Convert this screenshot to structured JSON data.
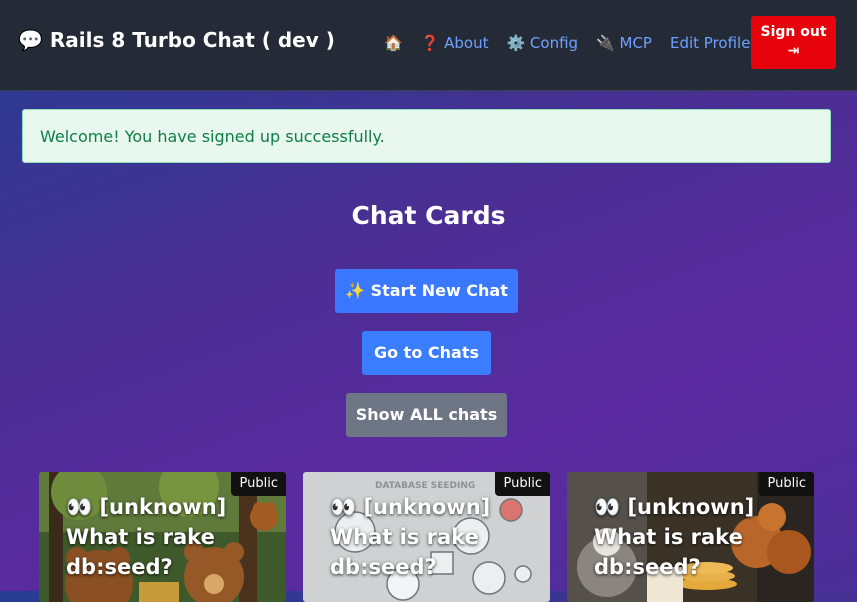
{
  "navbar": {
    "brand": "💬 Rails 8 Turbo Chat ( dev )",
    "links": [
      {
        "label": "🏠"
      },
      {
        "label": "❓ About"
      },
      {
        "label": "⚙️ Config"
      },
      {
        "label": "🔌 MCP"
      },
      {
        "label": "Edit Profile"
      }
    ],
    "signout_label": "Sign out",
    "signout_icon": "⇥"
  },
  "flash": {
    "message": "Welcome! You have signed up successfully."
  },
  "main": {
    "title": "Chat Cards",
    "buttons": {
      "new_chat": "✨ Start New Chat",
      "go_to_chats": "Go to Chats",
      "show_all": "Show ALL chats"
    }
  },
  "cards": [
    {
      "badge": "Public",
      "title": "👀 [unknown] What is rake db:seed?",
      "icon": "bears-picnic-image"
    },
    {
      "badge": "Public",
      "title": "👀 [unknown] What is rake db:seed?",
      "icon": "database-seeding-image",
      "image_caption": "DATABASE SEEDING"
    },
    {
      "badge": "Public",
      "title": "👀 [unknown] What is rake db:seed?",
      "icon": "squirrel-pancakes-image"
    }
  ],
  "colors": {
    "navbar_bg": "#252b36",
    "link": "#6ea0ff",
    "signout_bg": "#e6030c",
    "primary": "#3a78ff",
    "secondary": "#6e7584",
    "flash_bg": "#e8f8ef",
    "flash_text": "#0f7d45"
  }
}
